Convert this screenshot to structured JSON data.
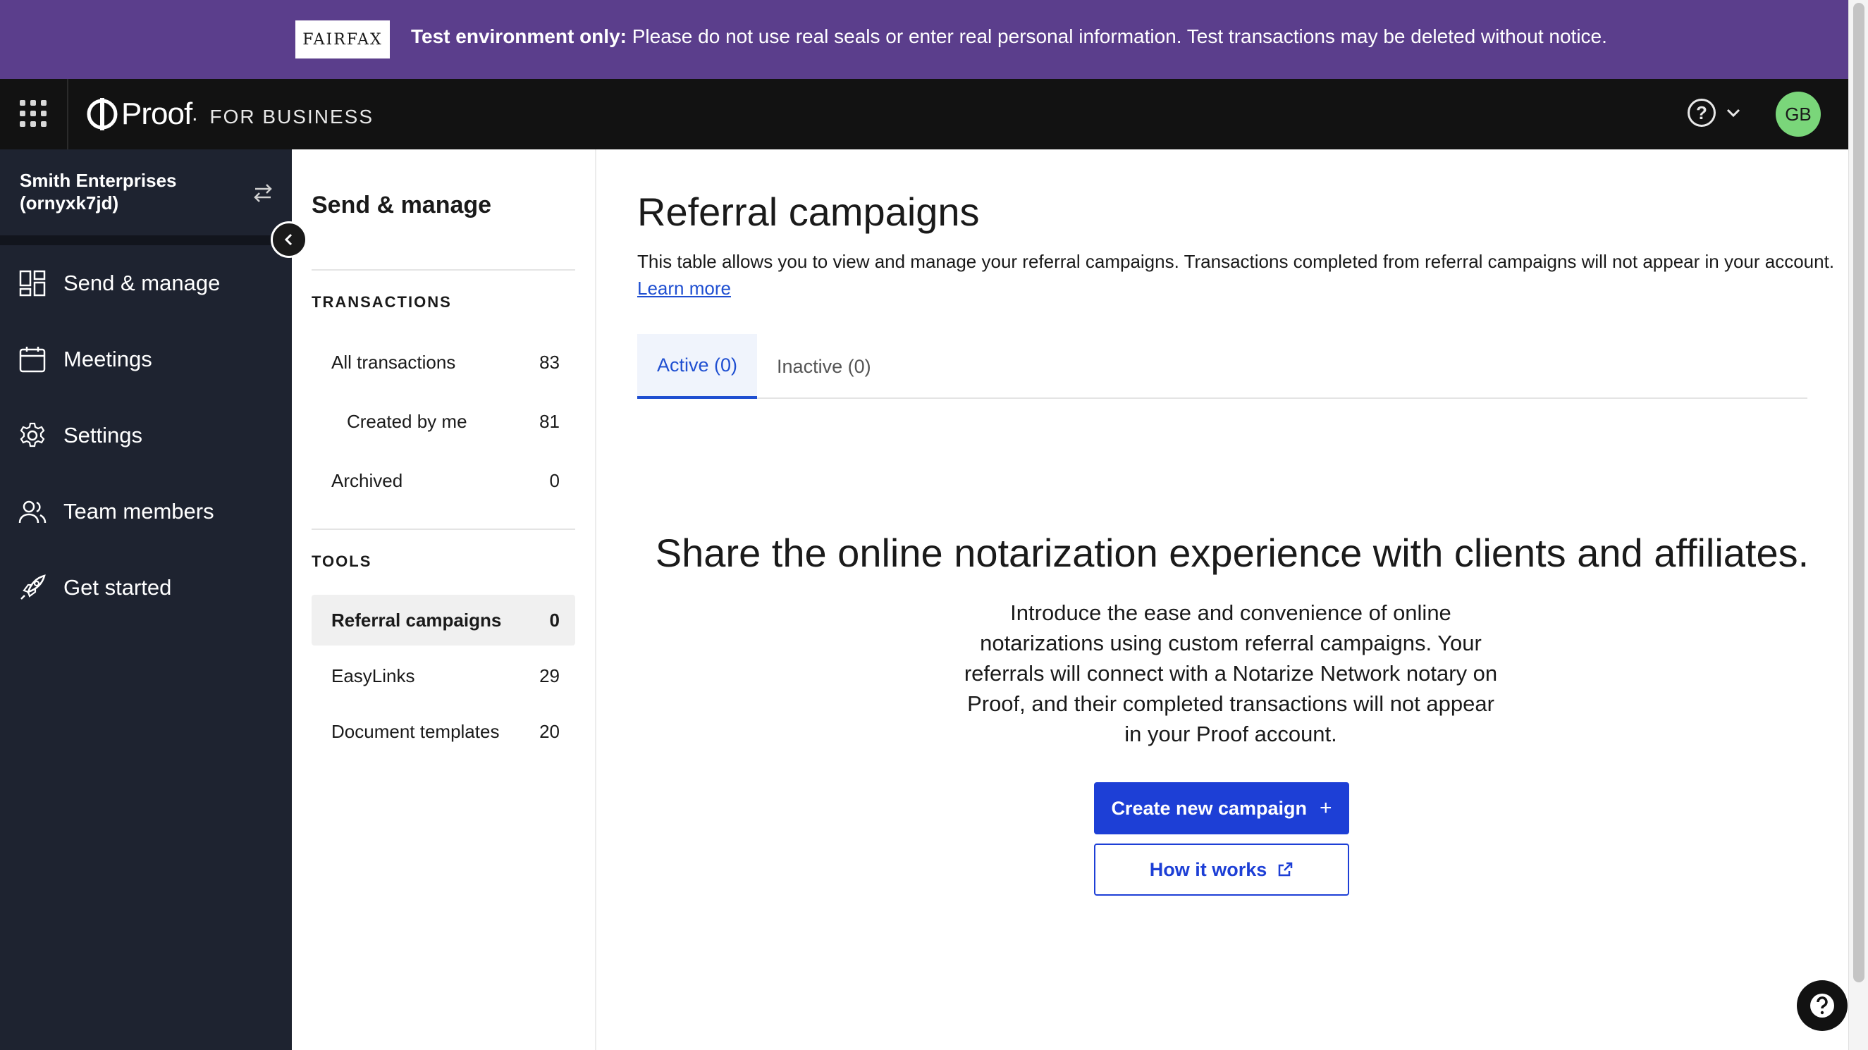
{
  "banner": {
    "logo_text": "FAIRFAX",
    "bold_text": "Test environment only:",
    "message": "Please do not use real seals or enter real personal information. Test transactions may be deleted without notice."
  },
  "header": {
    "brand_name": "Proof",
    "brand_dot": ".",
    "brand_sub": "FOR BUSINESS",
    "avatar_initials": "GB",
    "help_glyph": "?"
  },
  "sidebar": {
    "org_name": "Smith Enterprises",
    "org_id": "(ornyxk7jd)",
    "items": [
      {
        "label": "Send & manage",
        "icon": "dashboard-icon"
      },
      {
        "label": "Meetings",
        "icon": "calendar-icon"
      },
      {
        "label": "Settings",
        "icon": "gear-icon"
      },
      {
        "label": "Team members",
        "icon": "users-icon"
      },
      {
        "label": "Get started",
        "icon": "rocket-icon"
      }
    ]
  },
  "subpanel": {
    "title": "Send & manage",
    "transactions_heading": "TRANSACTIONS",
    "transactions": [
      {
        "label": "All transactions",
        "count": "83"
      },
      {
        "label": "Created by me",
        "count": "81"
      },
      {
        "label": "Archived",
        "count": "0"
      }
    ],
    "tools_heading": "TOOLS",
    "tools": [
      {
        "label": "Referral campaigns",
        "count": "0"
      },
      {
        "label": "EasyLinks",
        "count": "29"
      },
      {
        "label": "Document templates",
        "count": "20"
      }
    ]
  },
  "main": {
    "title": "Referral campaigns",
    "description": "This table allows you to view and manage your referral campaigns. Transactions completed from referral campaigns will not appear in your account.",
    "learn_more": "Learn more",
    "tabs": [
      {
        "label": "Active (0)"
      },
      {
        "label": "Inactive (0)"
      }
    ],
    "empty_heading": "Share the online notarization experience with clients and affiliates.",
    "empty_body": "Introduce the ease and convenience of online notarizations using custom referral campaigns. Your referrals will connect with a Notarize Network notary on Proof, and their completed transactions will not appear in your Proof account.",
    "create_button": "Create new campaign",
    "create_glyph": "+",
    "how_button": "How it works"
  },
  "colors": {
    "banner_bg": "#5b3e8c",
    "topbar_bg": "#121212",
    "sidebar_bg": "#1e2330",
    "accent": "#1d3fd6",
    "avatar_bg": "#7ad67a"
  }
}
